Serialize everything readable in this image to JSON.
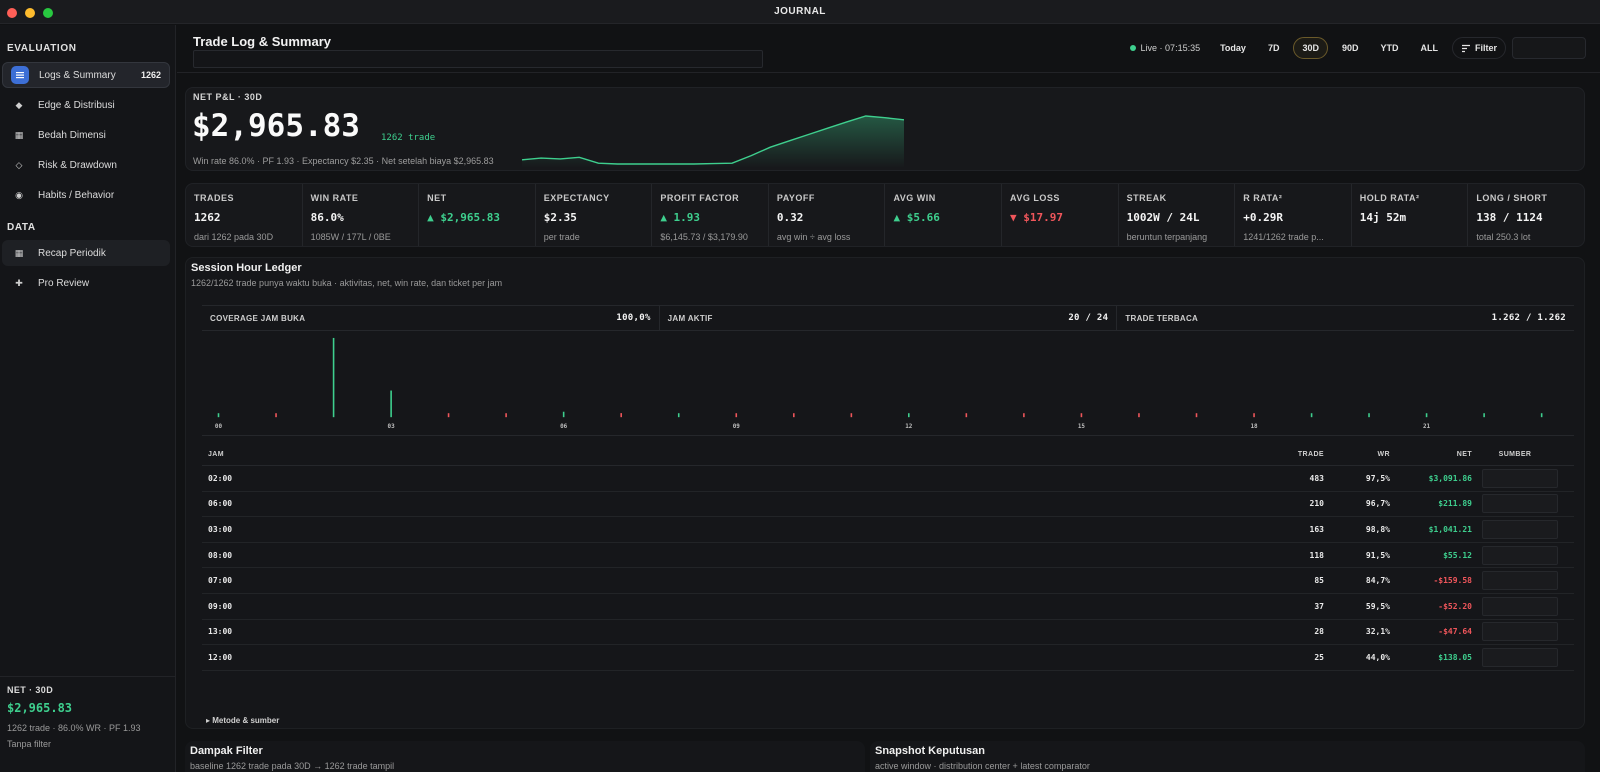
{
  "window": {
    "title": "JOURNAL"
  },
  "sidebar": {
    "sections": [
      "EVALUATION",
      "DATA"
    ],
    "items": [
      {
        "label": "Logs & Summary",
        "badge": "1262",
        "icon": "list-icon"
      },
      {
        "label": "Edge & Distribusi",
        "icon": "diamond-icon"
      },
      {
        "label": "Bedah Dimensi",
        "icon": "grid-icon"
      },
      {
        "label": "Risk & Drawdown",
        "icon": "diamond-outline-icon"
      },
      {
        "label": "Habits / Behavior",
        "icon": "circle-icon"
      },
      {
        "label": "Recap Periodik",
        "icon": "grid-icon"
      },
      {
        "label": "Pro Review",
        "icon": "plus-icon"
      }
    ],
    "footer": {
      "label": "NET · 30D",
      "value": "$2,965.83",
      "sub": "1262 trade · 86.0% WR · PF 1.93",
      "filter": "Tanpa filter"
    }
  },
  "header": {
    "title": "Trade Log & Summary",
    "live": "Live · 07:15:35",
    "ranges": [
      "Today",
      "7D",
      "30D",
      "90D",
      "YTD",
      "ALL"
    ],
    "selected_range": "30D",
    "filter_label": "Filter"
  },
  "pnl": {
    "label": "NET P&L · 30D",
    "value": "$2,965.83",
    "count": "1262 trade",
    "sub": "Win rate 86.0% · PF 1.93 · Expectancy $2.35 · Net setelah biaya $2,965.83"
  },
  "metrics": [
    {
      "label": "TRADES",
      "value": "1262",
      "sub": "dari 1262 pada 30D",
      "tone": ""
    },
    {
      "label": "WIN RATE",
      "value": "86.0%",
      "sub": "1085W / 177L / 0BE",
      "tone": ""
    },
    {
      "label": "NET",
      "value": "▲ $2,965.83",
      "sub": "",
      "tone": "pos"
    },
    {
      "label": "EXPECTANCY",
      "value": "$2.35",
      "sub": "per trade",
      "tone": ""
    },
    {
      "label": "PROFIT FACTOR",
      "value": "▲ 1.93",
      "sub": "$6,145.73 / $3,179.90",
      "tone": "pos"
    },
    {
      "label": "PAYOFF",
      "value": "0.32",
      "sub": "avg win ÷ avg loss",
      "tone": ""
    },
    {
      "label": "AVG WIN",
      "value": "▲ $5.66",
      "sub": "",
      "tone": "pos"
    },
    {
      "label": "AVG LOSS",
      "value": "▼ $17.97",
      "sub": "",
      "tone": "neg"
    },
    {
      "label": "STREAK",
      "value": "1002W / 24L",
      "sub": "beruntun terpanjang",
      "tone": ""
    },
    {
      "label": "R RATA²",
      "value": "+0.29R",
      "sub": "1241/1262 trade p...",
      "tone": ""
    },
    {
      "label": "HOLD RATA²",
      "value": "14j 52m",
      "sub": "",
      "tone": ""
    },
    {
      "label": "LONG / SHORT",
      "value": "138 / 1124",
      "sub": "total 250.3 lot",
      "tone": ""
    }
  ],
  "ledger": {
    "title": "Session Hour Ledger",
    "sub": "1262/1262 trade punya waktu buka · aktivitas, net, win rate, dan ticket per jam",
    "coverage": [
      {
        "label": "COVERAGE JAM BUKA",
        "value": "100,0%"
      },
      {
        "label": "JAM AKTIF",
        "value": "20 / 24"
      },
      {
        "label": "TRADE TERBACA",
        "value": "1.262 / 1.262"
      }
    ],
    "columns": {
      "jam": "JAM",
      "trade": "TRADE",
      "wr": "WR",
      "net": "NET",
      "sumber": "SUMBER"
    },
    "rows": [
      {
        "jam": "02:00",
        "trade": "483",
        "wr": "97,5%",
        "net": "$3,091.86",
        "tone": "pos"
      },
      {
        "jam": "06:00",
        "trade": "210",
        "wr": "96,7%",
        "net": "$211.89",
        "tone": "pos"
      },
      {
        "jam": "03:00",
        "trade": "163",
        "wr": "98,8%",
        "net": "$1,041.21",
        "tone": "pos"
      },
      {
        "jam": "08:00",
        "trade": "118",
        "wr": "91,5%",
        "net": "$55.12",
        "tone": "pos"
      },
      {
        "jam": "07:00",
        "trade": "85",
        "wr": "84,7%",
        "net": "-$159.58",
        "tone": "neg"
      },
      {
        "jam": "09:00",
        "trade": "37",
        "wr": "59,5%",
        "net": "-$52.20",
        "tone": "neg"
      },
      {
        "jam": "13:00",
        "trade": "28",
        "wr": "32,1%",
        "net": "-$47.64",
        "tone": "neg"
      },
      {
        "jam": "12:00",
        "trade": "25",
        "wr": "44,0%",
        "net": "$138.05",
        "tone": "pos"
      }
    ],
    "metode": "▸ Metode & sumber"
  },
  "chart_data": [
    {
      "type": "line",
      "title": "",
      "x": [
        0,
        1,
        2,
        3,
        4,
        5,
        6,
        7,
        8,
        9,
        10,
        11,
        12,
        13,
        14,
        15,
        16,
        17,
        18,
        19,
        20
      ],
      "series": [
        {
          "values": [
            0,
            4,
            2,
            6,
            -8,
            -10,
            -10,
            -10,
            -10,
            -10,
            -9,
            -8,
            10,
            30,
            45,
            60,
            75,
            90,
            104,
            100,
            95
          ]
        }
      ]
    },
    {
      "type": "bar",
      "title": "",
      "categories": [
        "00",
        "01",
        "02",
        "03",
        "04",
        "05",
        "06",
        "07",
        "08",
        "09",
        "10",
        "11",
        "12",
        "13",
        "14",
        "15",
        "16",
        "17",
        "18",
        "19",
        "20",
        "21",
        "22",
        "23"
      ],
      "tick_labels": [
        "00",
        "03",
        "06",
        "09",
        "12",
        "15",
        "18",
        "21"
      ],
      "values": [
        5,
        -5,
        3091.86,
        1041.21,
        -5,
        -5,
        211.89,
        -159.58,
        55.12,
        -52.2,
        -5,
        -5,
        138.05,
        -47.64,
        -5,
        -5,
        -5,
        -5,
        -5,
        5,
        5,
        5,
        5,
        5
      ]
    }
  ],
  "bottom": [
    {
      "title": "Dampak Filter",
      "sub": "baseline 1262 trade pada 30D → 1262 trade tampil"
    },
    {
      "title": "Snapshot Keputusan",
      "sub": "active window · distribution center + latest comparator"
    }
  ]
}
